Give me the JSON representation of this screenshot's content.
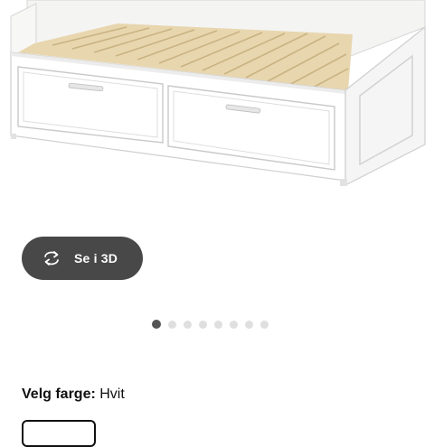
{
  "product": {
    "image_alt": "white daybed with two drawers"
  },
  "viewer": {
    "button_label": "Se i 3D",
    "icon": "rotate-3d-icon"
  },
  "carousel": {
    "count": 8,
    "active_index": 0
  },
  "color": {
    "label": "Velg farge:",
    "value": "Hvit"
  },
  "colors": {
    "button_bg": "#484848",
    "dot_active": "#555555",
    "dot_inactive": "#dfdfdf"
  }
}
